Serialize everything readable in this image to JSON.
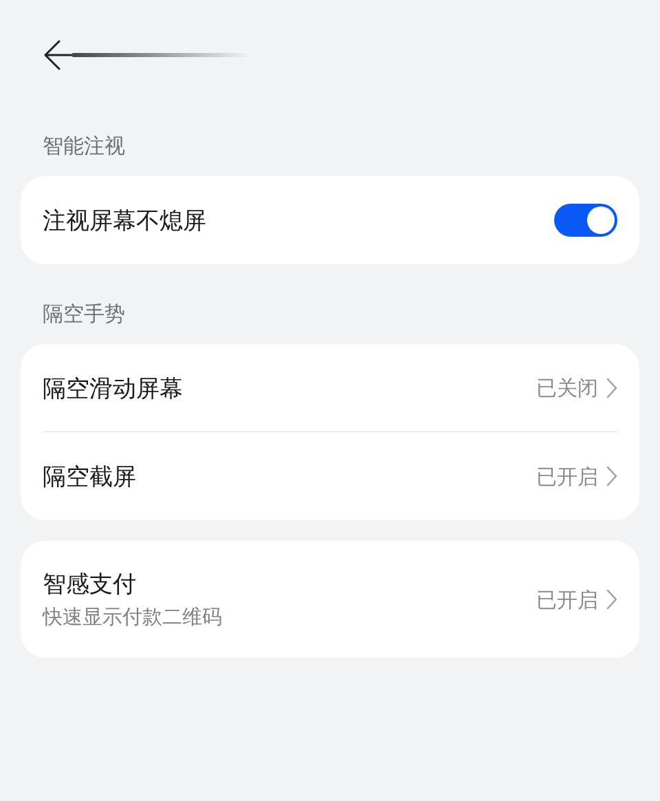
{
  "groups": [
    {
      "title": "智能注视",
      "items": [
        {
          "kind": "toggle",
          "label": "注视屏幕不熄屏",
          "on": true
        }
      ]
    },
    {
      "title": "隔空手势",
      "items": [
        {
          "kind": "link",
          "label": "隔空滑动屏幕",
          "value": "已关闭"
        },
        {
          "kind": "link",
          "label": "隔空截屏",
          "value": "已开启"
        }
      ]
    },
    {
      "items": [
        {
          "kind": "link",
          "label": "智感支付",
          "subtitle": "快速显示付款二维码",
          "value": "已开启"
        }
      ]
    }
  ]
}
